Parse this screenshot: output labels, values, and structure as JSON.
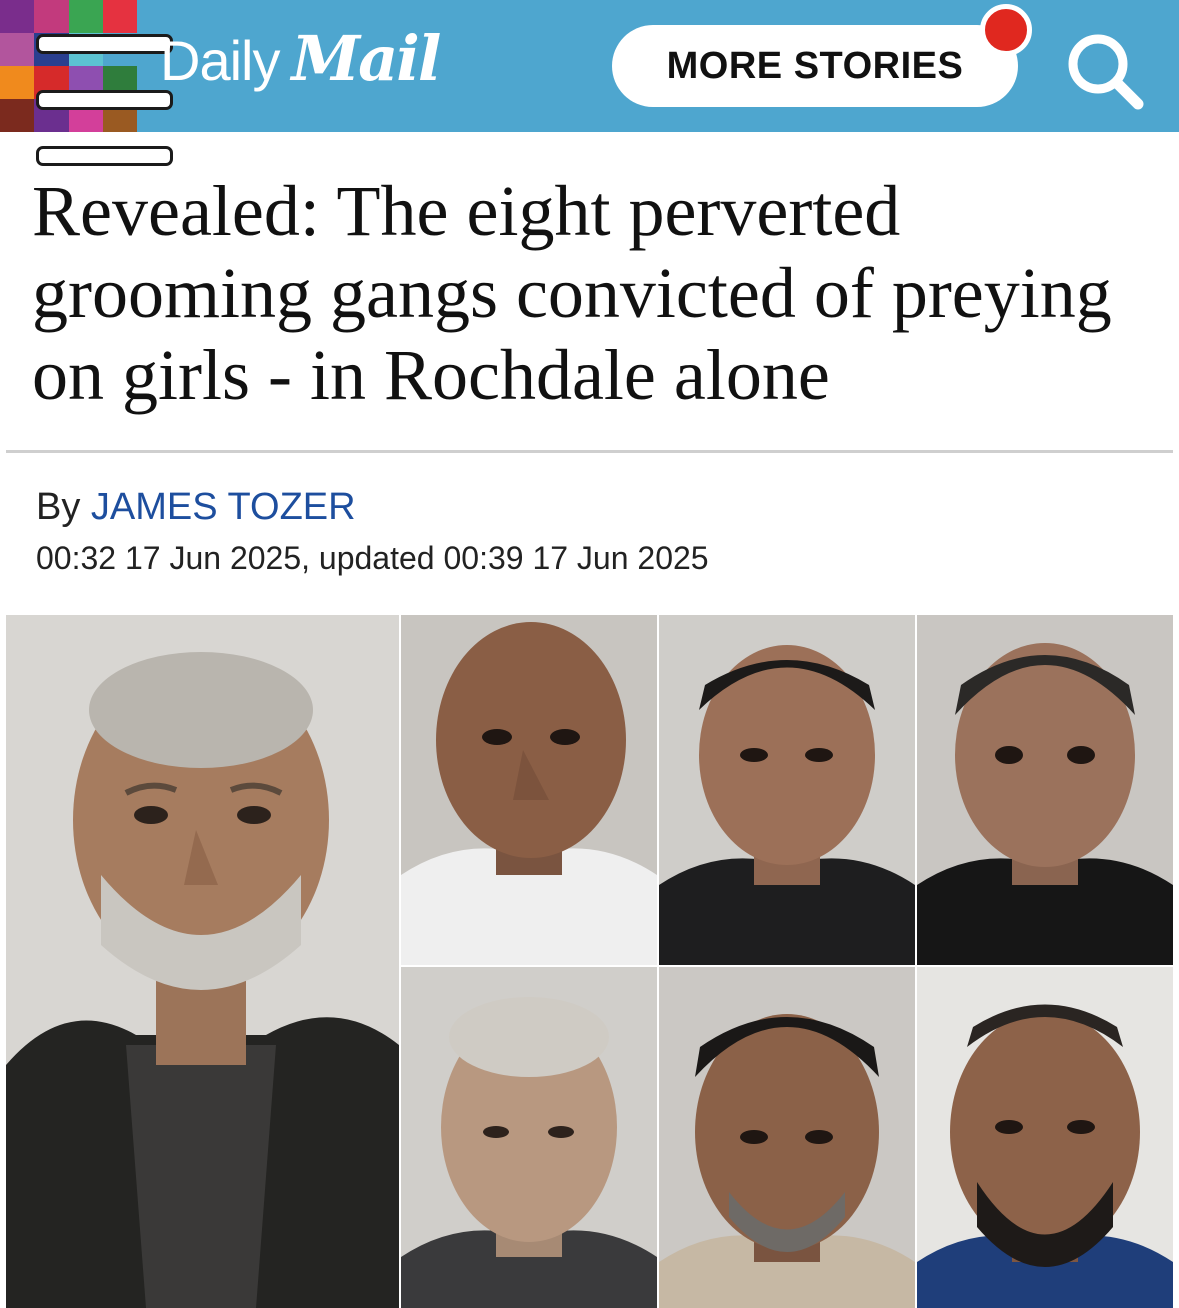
{
  "header": {
    "logo_daily": "Daily",
    "logo_mail": "Mail",
    "more_stories_label": "MORE STORIES",
    "icons": [
      "menu-icon",
      "notification-dot",
      "search-icon"
    ],
    "colors": {
      "header_bg": "#4ea6cf",
      "notification": "#e0281f",
      "author_link": "#1d4e9e"
    }
  },
  "article": {
    "headline": "Revealed: The eight perverted grooming gangs convicted of preying on girls - in Rochdale alone",
    "byline_prefix": "By",
    "author": "JAMES TOZER",
    "dateline": "00:32 17 Jun 2025, updated 00:39 17 Jun 2025"
  }
}
